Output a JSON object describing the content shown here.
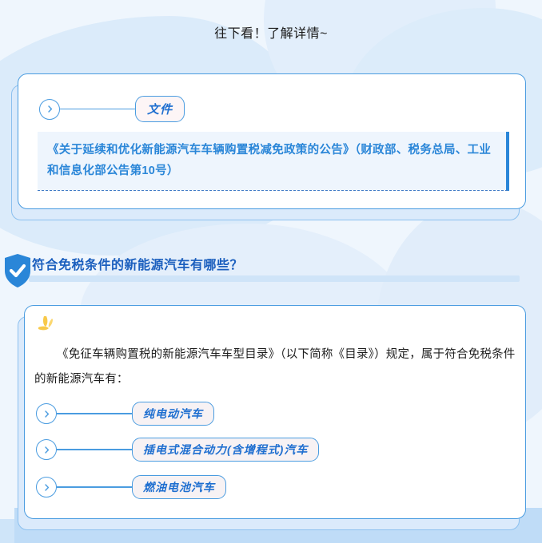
{
  "header": {
    "lead_text": "往下看！了解详情~"
  },
  "doc_card": {
    "badge": {
      "label": "文件",
      "chevron_icon": "chevron-right-icon"
    },
    "quote": "《关于延续和优化新能源汽车车辆购置税减免政策的公告》（财政部、税务总局、工业和信息化部公告第10号）"
  },
  "section": {
    "icon": "shield-check-icon",
    "title": "符合免税条件的新能源汽车有哪些？"
  },
  "list_card": {
    "decoration_icon": "sparkle-icon",
    "body": "《免征车辆购置税的新能源汽车车型目录》（以下简称《目录》）规定，属于符合免税条件的新能源汽车有：",
    "items": [
      {
        "label": "纯电动汽车",
        "chevron_icon": "chevron-right-icon"
      },
      {
        "label": "插电式混合动力(含增程式)汽车",
        "chevron_icon": "chevron-right-icon"
      },
      {
        "label": "燃油电池汽车",
        "chevron_icon": "chevron-right-icon"
      }
    ]
  },
  "colors": {
    "page_bg": "#eff6fd",
    "accent_blue": "#2a86d8",
    "border_blue": "#4a9ce0",
    "heading_blue": "#1b5fbe",
    "quote_bg": "#eef5fd",
    "pill_bg": "#fdf5f6",
    "sparkle_yellow": "#f8c949",
    "band_blue": "#bfdcf7"
  }
}
